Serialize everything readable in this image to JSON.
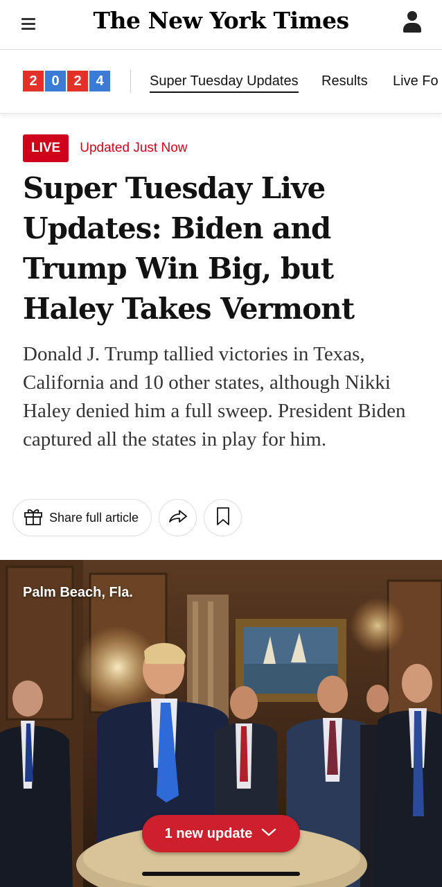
{
  "header": {
    "masthead": "The New York Times",
    "menu_icon": "hamburger-icon",
    "account_icon": "user-icon"
  },
  "subnav": {
    "year_digits": [
      "2",
      "0",
      "2",
      "4"
    ],
    "links": [
      "Super Tuesday Updates",
      "Results",
      "Live Fo"
    ],
    "active_index": 0
  },
  "article": {
    "live_badge": "LIVE",
    "updated": "Updated Just Now",
    "headline": "Super Tuesday Live Updates: Biden and Trump Win Big, but Haley Takes Vermont",
    "summary": "Donald J. Trump tallied victories in Texas, California and 10 other states, although Nikki Haley denied him a full sweep. President Biden captured all the states in play for him."
  },
  "actions": {
    "share_label": "Share full article",
    "gift_icon": "gift-icon",
    "share_icon": "share-arrow-icon",
    "bookmark_icon": "bookmark-icon"
  },
  "photo": {
    "dateline": "Palm Beach, Fla."
  },
  "updates_pill": {
    "label": "1 new update",
    "icon": "chevron-down-icon"
  },
  "colors": {
    "live_red": "#d0021b",
    "pill_red": "#cd1f2c",
    "year_red": "#e3312a",
    "year_blue": "#3a7bd5"
  }
}
